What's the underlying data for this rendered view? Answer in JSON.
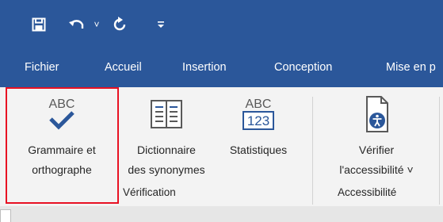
{
  "quick_access": {
    "save_icon": "save-icon",
    "undo_icon": "undo-icon",
    "undo_dropdown_icon": "chevron-down-icon",
    "redo_icon": "redo-icon",
    "customize_icon": "customize-qat-icon"
  },
  "tabs": [
    "Fichier",
    "Accueil",
    "Insertion",
    "Conception",
    "Mise en p"
  ],
  "ribbon": {
    "verification": {
      "group_label": "Vérification",
      "buttons": [
        {
          "line1": "Grammaire et",
          "line2": "orthographe",
          "icon": "spelling-check-icon",
          "icon_text": "ABC"
        },
        {
          "line1": "Dictionnaire",
          "line2": "des synonymes",
          "icon": "thesaurus-book-icon"
        },
        {
          "line1": "Statistiques",
          "line2": "",
          "icon": "word-count-icon",
          "icon_text_top": "ABC",
          "icon_text_bottom": "123"
        }
      ]
    },
    "accessibility": {
      "group_label": "Accessibilité",
      "button": {
        "line1": "Vérifier",
        "line2": "l'accessibilité ˅",
        "icon": "accessibility-check-icon"
      }
    }
  },
  "colors": {
    "accent": "#2b579a",
    "ribbon_bg": "#f3f3f3",
    "check_blue": "#2b579a",
    "highlight_border": "#e81123"
  }
}
